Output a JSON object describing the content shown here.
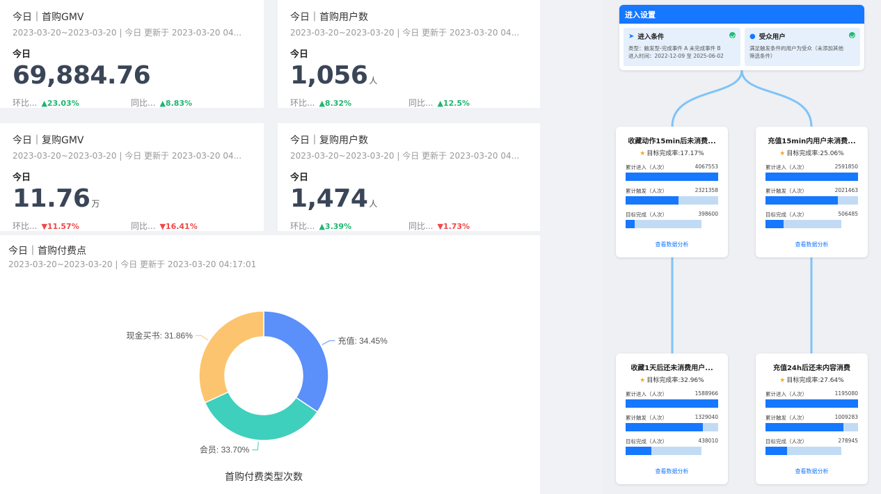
{
  "kpis": [
    {
      "title": "今日｜首购GMV",
      "sub": "2023-03-20~2023-03-20 | 今日 更新于 2023-03-20 04...",
      "label": "今日",
      "value": "69,884.76",
      "unit": "",
      "mom_label": "环比...",
      "mom": "▲23.03%",
      "yoy_label": "同比...",
      "yoy": "▲8.83%"
    },
    {
      "title": "今日｜首购用户数",
      "sub": "2023-03-20~2023-03-20 | 今日 更新于 2023-03-20 04...",
      "label": "今日",
      "value": "1,056",
      "unit": "人",
      "mom_label": "环比...",
      "mom": "▲8.32%",
      "yoy_label": "同比...",
      "yoy": "▲12.5%"
    },
    {
      "title": "今日｜复购GMV",
      "sub": "2023-03-20~2023-03-20 | 今日 更新于 2023-03-20 04...",
      "label": "今日",
      "value": "11.76",
      "unit": "万",
      "mom_label": "环比...",
      "mom": "▼11.57%",
      "yoy_label": "同比...",
      "yoy": "▼16.41%"
    },
    {
      "title": "今日｜复购用户数",
      "sub": "2023-03-20~2023-03-20 | 今日 更新于 2023-03-20 04...",
      "label": "今日",
      "value": "1,474",
      "unit": "人",
      "mom_label": "环比...",
      "mom": "▲3.39%",
      "yoy_label": "同比...",
      "yoy": "▼1.73%"
    }
  ],
  "chart_panel": {
    "title": "今日｜首购付费点",
    "sub": "2023-03-20~2023-03-20 | 今日 更新于 2023-03-20 04:17:01"
  },
  "chart_data": {
    "type": "pie",
    "donut": true,
    "title": "",
    "caption": "首购付费类型次数",
    "slices": [
      {
        "name": "充值",
        "value": 34.45,
        "label": "充值: 34.45%",
        "color": "#5b8ff9"
      },
      {
        "name": "会员",
        "value": 33.7,
        "label": "会员: 33.70%",
        "color": "#3fcfbd"
      },
      {
        "name": "现金买书",
        "value": 31.86,
        "label": "现金买书: 31.86%",
        "color": "#fcc46e"
      }
    ]
  },
  "flow": {
    "entry": {
      "header": "进入设置",
      "condition": {
        "title": "进入条件",
        "line1": "类型：触发型-完成事件 A 未完成事件 B",
        "line2": "进入时间：2022-12-09 至 2025-06-02"
      },
      "audience": {
        "title": "受众用户",
        "line1": "满足触发条件的用户为受众（未添加其他",
        "line2": "筛选条件）"
      }
    },
    "nodes": [
      {
        "title": "收藏动作15min后未消费...",
        "rate": "目标完成率:17.17%",
        "metrics": [
          {
            "label": "累计进入（人次）",
            "value": "4067553",
            "ratio": 1.0
          },
          {
            "label": "累计触发（人次）",
            "value": "2321358",
            "ratio": 0.57
          },
          {
            "label": "目标完成（人次）",
            "value": "398600",
            "ratio": 0.098
          }
        ],
        "link": "查看数据分析"
      },
      {
        "title": "充值15min内用户未消费...",
        "rate": "目标完成率:25.06%",
        "metrics": [
          {
            "label": "累计进入（人次）",
            "value": "2591850",
            "ratio": 1.0
          },
          {
            "label": "累计触发（人次）",
            "value": "2021463",
            "ratio": 0.78
          },
          {
            "label": "目标完成（人次）",
            "value": "506485",
            "ratio": 0.195
          }
        ],
        "link": "查看数据分析"
      },
      {
        "title": "收藏1天后还未消费用户...",
        "rate": "目标完成率:32.96%",
        "metrics": [
          {
            "label": "累计进入（人次）",
            "value": "1588966",
            "ratio": 1.0
          },
          {
            "label": "累计触发（人次）",
            "value": "1329040",
            "ratio": 0.836
          },
          {
            "label": "目标完成（人次）",
            "value": "438010",
            "ratio": 0.276
          }
        ],
        "link": "查看数据分析"
      },
      {
        "title": "充值24h后还未内容消费",
        "rate": "目标完成率:27.64%",
        "metrics": [
          {
            "label": "累计进入（人次）",
            "value": "1195080",
            "ratio": 1.0
          },
          {
            "label": "累计触发（人次）",
            "value": "1009283",
            "ratio": 0.845
          },
          {
            "label": "目标完成（人次）",
            "value": "278945",
            "ratio": 0.233
          }
        ],
        "link": "查看数据分析"
      }
    ]
  }
}
